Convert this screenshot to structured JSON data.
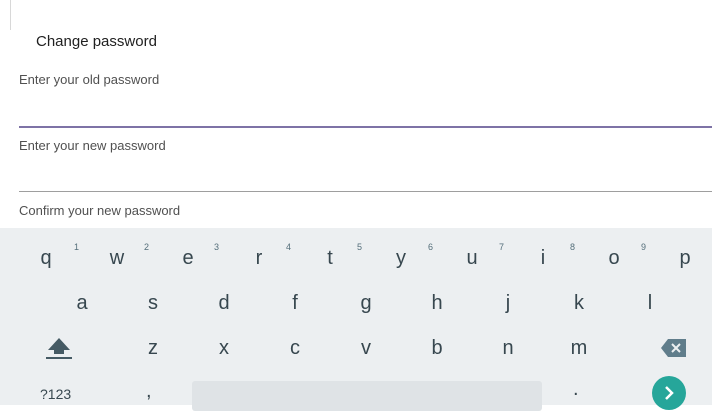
{
  "dialog": {
    "title": "Change password",
    "fields": [
      {
        "placeholder": "Enter your old password",
        "value": ""
      },
      {
        "placeholder": "Enter your new password",
        "value": ""
      },
      {
        "placeholder": "Confirm your new password",
        "value": ""
      }
    ]
  },
  "keyboard": {
    "row1": [
      {
        "key": "q",
        "hint": "1"
      },
      {
        "key": "w",
        "hint": "2"
      },
      {
        "key": "e",
        "hint": "3"
      },
      {
        "key": "r",
        "hint": "4"
      },
      {
        "key": "t",
        "hint": "5"
      },
      {
        "key": "y",
        "hint": "6"
      },
      {
        "key": "u",
        "hint": "7"
      },
      {
        "key": "i",
        "hint": "8"
      },
      {
        "key": "o",
        "hint": "9"
      },
      {
        "key": "p",
        "hint": ""
      }
    ],
    "row2": [
      "a",
      "s",
      "d",
      "f",
      "g",
      "h",
      "j",
      "k",
      "l"
    ],
    "row3": [
      "z",
      "x",
      "c",
      "v",
      "b",
      "n",
      "m"
    ],
    "symbols_label": "?123",
    "comma": ",",
    "period": ".",
    "icons": {
      "shift": "shift-icon",
      "backspace": "backspace-icon",
      "enter": "go-arrow-icon"
    },
    "colors": {
      "background": "#eceff1",
      "enter_key": "#26a69a",
      "focused_underline": "#7e73a6"
    }
  }
}
